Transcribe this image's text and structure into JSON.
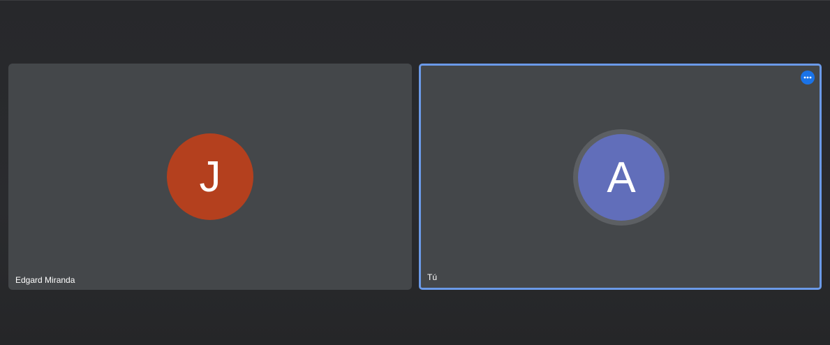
{
  "participants": [
    {
      "name": "Edgard Miranda",
      "initial": "J",
      "avatar_color": "#b4401e"
    },
    {
      "name": "Tú",
      "initial": "A",
      "avatar_color": "#616eba",
      "active": true
    }
  ],
  "colors": {
    "tile_background": "#44474a",
    "active_border": "#6b9ae8",
    "more_button": "#1a73e8"
  },
  "icons": {
    "more_options": "more-horizontal-icon"
  }
}
